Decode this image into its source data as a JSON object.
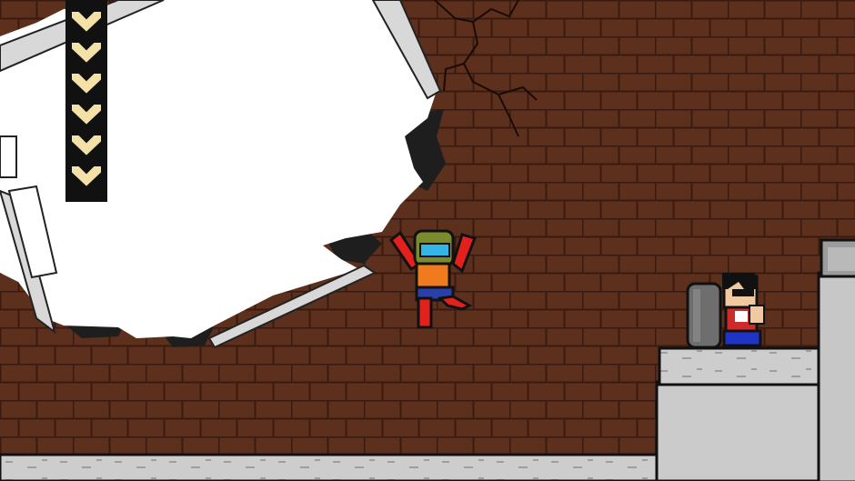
{
  "game": {
    "title": "",
    "hud": {
      "health": {
        "max_hearts": 6,
        "current_hearts": 6
      }
    },
    "scene": {
      "background": "brick-wall",
      "hole": "broken-wall-opening",
      "player": {
        "state": "jumping",
        "colors": {
          "suit": "#e3211c",
          "shirt": "#f07b1e",
          "helmet": "#7a8a2e",
          "visor": "#33b5e5",
          "shorts": "#2a3fa8"
        }
      },
      "enemy": {
        "type": "riot-shield-guard",
        "colors": {
          "shirt": "#cf2a2a",
          "pants": "#1f33c7",
          "shield": "#6e6e6e"
        }
      }
    },
    "colors": {
      "brick": "#5c301d",
      "mortar": "#3a1a0e",
      "concrete": "#cdcdcd",
      "heart": "#f3e1a8",
      "heart_bg": "#111111"
    }
  }
}
